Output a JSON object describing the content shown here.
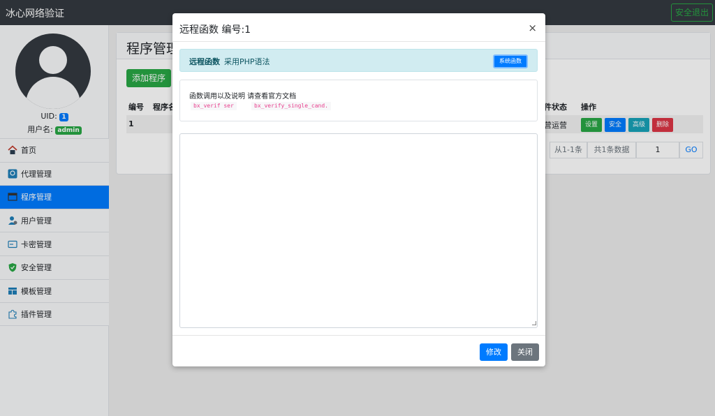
{
  "topbar": {
    "brand": "冰心网络验证",
    "logout_label": "安全退出"
  },
  "sidebar": {
    "uid_label": "UID:",
    "uid_value": "1",
    "username_label": "用户名:",
    "username_value": "admin",
    "items": [
      {
        "label": "首页",
        "icon": "home-icon",
        "active": false
      },
      {
        "label": "代理管理",
        "icon": "agent-icon",
        "active": false
      },
      {
        "label": "程序管理",
        "icon": "program-icon",
        "active": true
      },
      {
        "label": "用户管理",
        "icon": "users-icon",
        "active": false
      },
      {
        "label": "卡密管理",
        "icon": "card-icon",
        "active": false
      },
      {
        "label": "安全管理",
        "icon": "shield-icon",
        "active": false
      },
      {
        "label": "模板管理",
        "icon": "template-icon",
        "active": false
      },
      {
        "label": "插件管理",
        "icon": "puzzle-icon",
        "active": false
      }
    ]
  },
  "main": {
    "title": "程序管理",
    "add_button": "添加程序",
    "columns": {
      "id": "编号",
      "name": "程序名",
      "status": "件状态",
      "ops": "操作"
    },
    "row": {
      "id": "1",
      "status": "营运营"
    },
    "row_buttons": {
      "settings": "设置",
      "security": "安全",
      "advanced": "高级",
      "delete": "删除"
    },
    "pager": {
      "range": "从1-1条",
      "total": "共1条数据",
      "page": "1",
      "go": "GO"
    }
  },
  "modal": {
    "title": "远程函数 编号:1",
    "close": "×",
    "alert_bold": "远程函数",
    "alert_text": "采用PHP语法",
    "sys_button": "系统函数",
    "info_text": "函数调用以及说明 请查看官方文档",
    "code1": "bx_verif      ser",
    "code2": "bx_verify_single_cand.",
    "textarea_value": "",
    "save_button": "修改",
    "close_button": "关闭"
  }
}
